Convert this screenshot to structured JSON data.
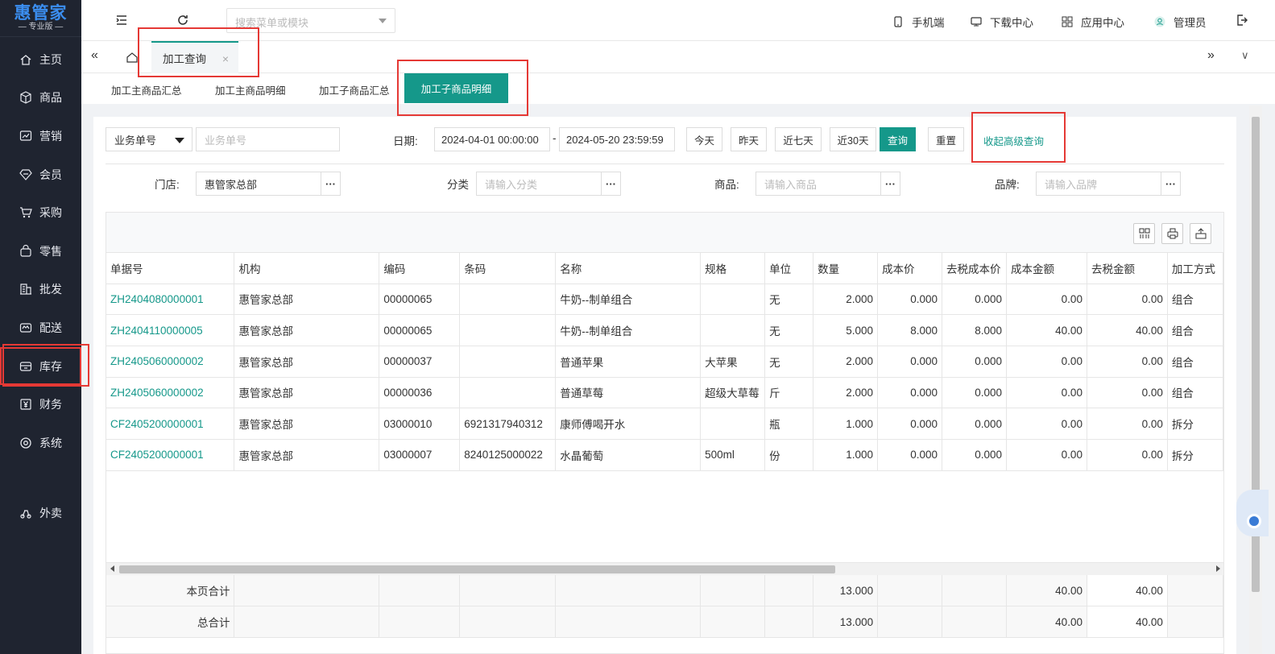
{
  "brand": {
    "title": "惠管家",
    "subtitle": "— 专业版 —"
  },
  "sidebar": {
    "items": [
      {
        "label": "主页",
        "icon": "home-icon"
      },
      {
        "label": "商品",
        "icon": "cube-icon"
      },
      {
        "label": "营销",
        "icon": "chart-icon"
      },
      {
        "label": "会员",
        "icon": "diamond-icon"
      },
      {
        "label": "采购",
        "icon": "cart-icon"
      },
      {
        "label": "零售",
        "icon": "bag-icon"
      },
      {
        "label": "批发",
        "icon": "building-icon"
      },
      {
        "label": "配送",
        "icon": "truck-icon"
      },
      {
        "label": "库存",
        "icon": "box-icon"
      },
      {
        "label": "财务",
        "icon": "yen-icon"
      },
      {
        "label": "系统",
        "icon": "settings-icon"
      },
      {
        "label": "外卖",
        "icon": "scooter-icon"
      }
    ],
    "active": "库存"
  },
  "topbar": {
    "search_placeholder": "搜索菜单或模块",
    "mobile": "手机端",
    "download": "下载中心",
    "apps": "应用中心",
    "user": "管理员"
  },
  "tabs": {
    "active_label": "加工查询",
    "close": "×",
    "prev": "«",
    "next": "»",
    "dropdown": "∨"
  },
  "subtabs": [
    "加工主商品汇总",
    "加工主商品明细",
    "加工子商品汇总",
    "加工子商品明细"
  ],
  "filters": {
    "doc_type": "业务单号",
    "doc_placeholder": "业务单号",
    "date_label": "日期:",
    "date_start": "2024-04-01 00:00:00",
    "date_sep": "-",
    "date_end": "2024-05-20 23:59:59",
    "btn_today": "今天",
    "btn_yesterday": "昨天",
    "btn_7days": "近七天",
    "btn_30days": "近30天",
    "btn_query": "查询",
    "btn_reset": "重置",
    "btn_collapse": "收起高级查询",
    "store_label": "门店:",
    "store_value": "惠管家总部",
    "category_label": "分类",
    "category_placeholder": "请输入分类",
    "product_label": "商品:",
    "product_placeholder": "请输入商品",
    "brand_label": "品牌:",
    "brand_placeholder": "请输入品牌",
    "dots": "···"
  },
  "table": {
    "columns": [
      "单据号",
      "机构",
      "编码",
      "条码",
      "名称",
      "规格",
      "单位",
      "数量",
      "成本价",
      "去税成本价",
      "成本金额",
      "去税金额",
      "加工方式"
    ],
    "rows": [
      [
        "ZH2404080000001",
        "惠管家总部",
        "00000065",
        "",
        "牛奶--制单组合",
        "",
        "无",
        "2.000",
        "0.000",
        "0.000",
        "0.00",
        "0.00",
        "组合"
      ],
      [
        "ZH2404110000005",
        "惠管家总部",
        "00000065",
        "",
        "牛奶--制单组合",
        "",
        "无",
        "5.000",
        "8.000",
        "8.000",
        "40.00",
        "40.00",
        "组合"
      ],
      [
        "ZH2405060000002",
        "惠管家总部",
        "00000037",
        "",
        "普通苹果",
        "大苹果",
        "无",
        "2.000",
        "0.000",
        "0.000",
        "0.00",
        "0.00",
        "组合"
      ],
      [
        "ZH2405060000002",
        "惠管家总部",
        "00000036",
        "",
        "普通草莓",
        "超级大草莓",
        "斤",
        "2.000",
        "0.000",
        "0.000",
        "0.00",
        "0.00",
        "组合"
      ],
      [
        "CF2405200000001",
        "惠管家总部",
        "03000010",
        "6921317940312",
        "康师傅喝开水",
        "",
        "瓶",
        "1.000",
        "0.000",
        "0.000",
        "0.00",
        "0.00",
        "拆分"
      ],
      [
        "CF2405200000001",
        "惠管家总部",
        "03000007",
        "8240125000022",
        "水晶葡萄",
        "500ml",
        "份",
        "1.000",
        "0.000",
        "0.000",
        "0.00",
        "0.00",
        "拆分"
      ]
    ],
    "footer": [
      {
        "label": "本页合计",
        "qty": "13.000",
        "cost_amount": "40.00",
        "notax_amount": "40.00"
      },
      {
        "label": "总合计",
        "qty": "13.000",
        "cost_amount": "40.00",
        "notax_amount": "40.00"
      }
    ]
  }
}
